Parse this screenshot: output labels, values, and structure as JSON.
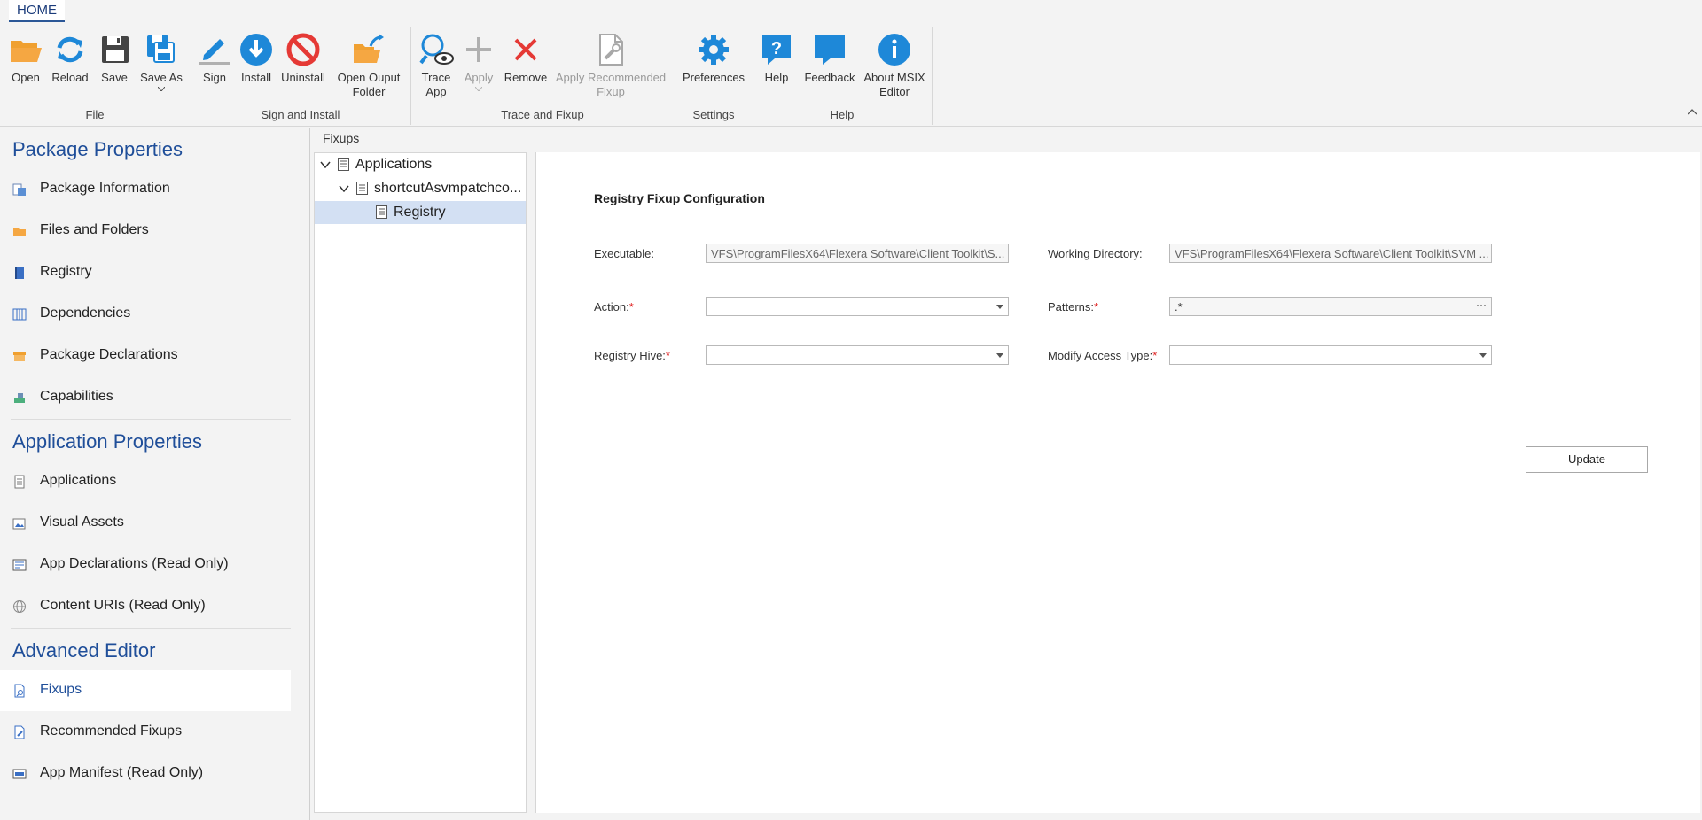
{
  "tabs": {
    "home": "HOME"
  },
  "ribbon": {
    "groups": {
      "file": "File",
      "sign_install": "Sign and Install",
      "trace_fixup": "Trace and Fixup",
      "settings": "Settings",
      "help": "Help"
    },
    "buttons": {
      "open": "Open",
      "reload": "Reload",
      "save": "Save",
      "save_as": "Save As",
      "sign": "Sign",
      "install": "Install",
      "uninstall": "Uninstall",
      "open_output_l1": "Open Ouput",
      "open_output_l2": "Folder",
      "trace_l1": "Trace",
      "trace_l2": "App",
      "apply": "Apply",
      "remove": "Remove",
      "apply_rec_l1": "Apply Recommended",
      "apply_rec_l2": "Fixup",
      "preferences": "Preferences",
      "help": "Help",
      "feedback": "Feedback",
      "about_l1": "About MSIX",
      "about_l2": "Editor"
    }
  },
  "sidebar": {
    "package_properties": "Package Properties",
    "application_properties": "Application Properties",
    "advanced_editor": "Advanced Editor",
    "items": {
      "package_information": "Package Information",
      "files_and_folders": "Files and Folders",
      "registry": "Registry",
      "dependencies": "Dependencies",
      "package_declarations": "Package Declarations",
      "capabilities": "Capabilities",
      "applications": "Applications",
      "visual_assets": "Visual Assets",
      "app_declarations": "App Declarations (Read Only)",
      "content_uris": "Content URIs (Read Only)",
      "fixups": "Fixups",
      "recommended_fixups": "Recommended Fixups",
      "app_manifest": "App Manifest (Read Only)"
    }
  },
  "content": {
    "title": "Fixups",
    "tree": {
      "applications": "Applications",
      "app_node": "shortcutAsvmpatchco...",
      "registry": "Registry"
    },
    "form": {
      "title": "Registry Fixup Configuration",
      "executable_label": "Executable:",
      "executable_value": "VFS\\ProgramFilesX64\\Flexera Software\\Client Toolkit\\S...",
      "working_dir_label": "Working Directory:",
      "working_dir_value": "VFS\\ProgramFilesX64\\Flexera Software\\Client Toolkit\\SVM ...",
      "action_label": "Action:",
      "action_value": "",
      "patterns_label": "Patterns:",
      "patterns_value": ".*",
      "hive_label": "Registry Hive:",
      "hive_value": "",
      "access_label": "Modify Access Type:",
      "access_value": "",
      "required_mark": "*",
      "update_button": "Update"
    }
  },
  "colors": {
    "accent": "#1f4e99",
    "icon_blue": "#1e88d8",
    "icon_red": "#e53935",
    "folder_orange": "#f5a742"
  }
}
